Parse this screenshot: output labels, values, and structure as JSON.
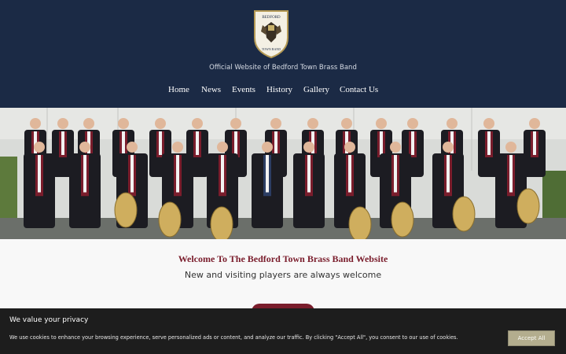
{
  "site": {
    "logo_top_text": "BEDFORD",
    "logo_bottom_text": "TOWN BAND",
    "tagline": "Official Website of Bedford Town Brass Band"
  },
  "nav": {
    "items": [
      "Home",
      "News",
      "Events",
      "History",
      "Gallery",
      "Contact Us"
    ]
  },
  "hero": {
    "image_icon": "band-group-photo"
  },
  "welcome": {
    "title": "Welcome To The Bedford Town Brass Band Website",
    "subtitle": "New and visiting players are always welcome"
  },
  "cookie": {
    "title": "We value your privacy",
    "text": "We use cookies to enhance your browsing experience, serve personalized ads or content, and analyze our traffic. By clicking \"Accept All\", you consent to our use of cookies.",
    "accept_label": "Accept All"
  },
  "colors": {
    "header_bg": "#1b2a45",
    "brand_maroon": "#7a1d2c",
    "cookie_bg": "#1d1d1d",
    "accept_bg": "#b3ad8e"
  }
}
